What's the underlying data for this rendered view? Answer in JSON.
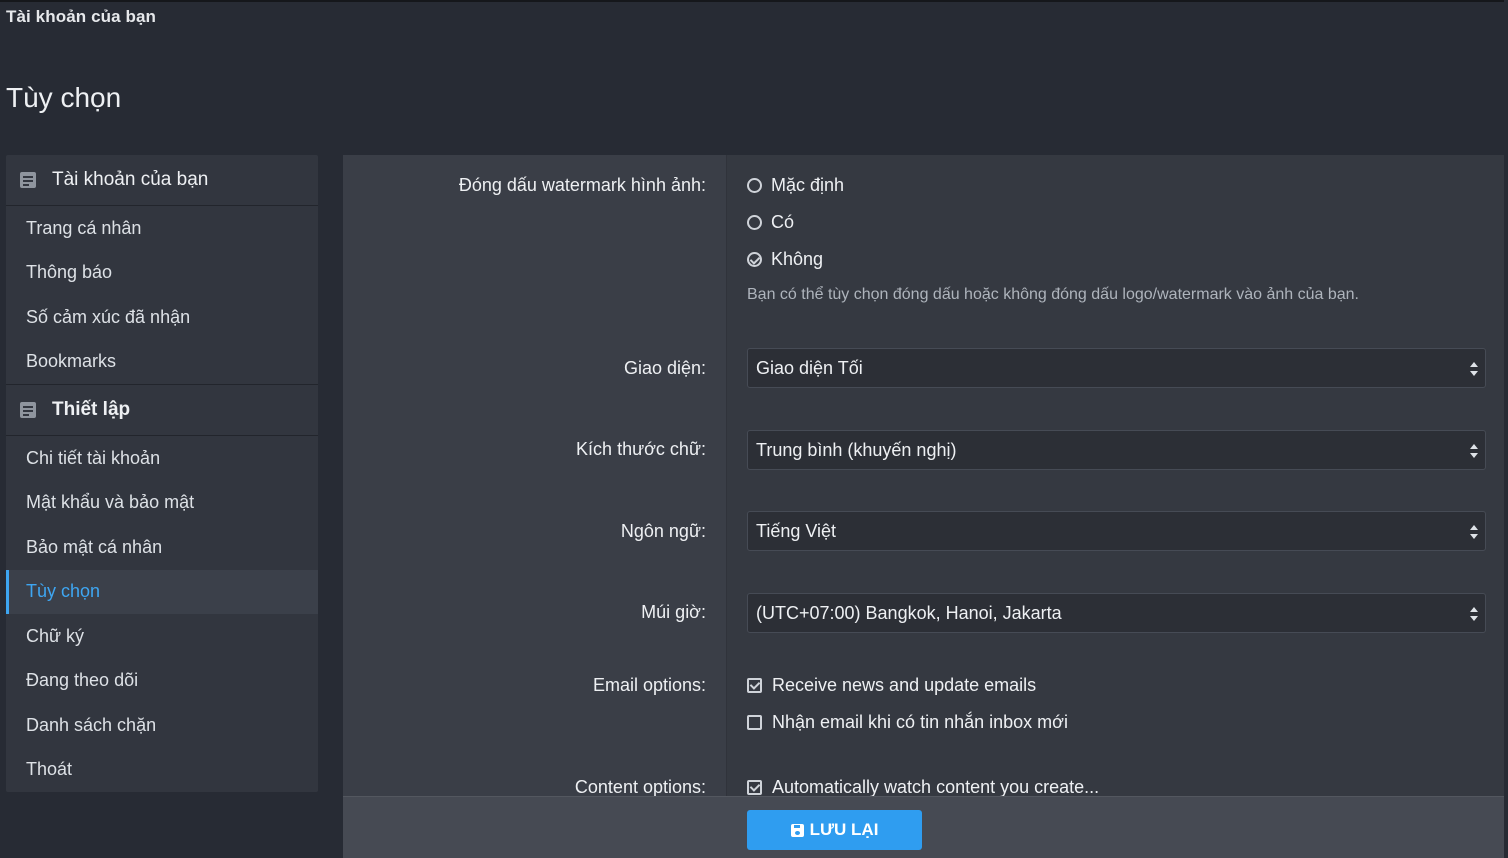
{
  "breadcrumb": "Tài khoản của bạn",
  "page_title": "Tùy chọn",
  "sidebar": {
    "groups": [
      {
        "header": "Tài khoản của bạn",
        "items": [
          "Trang cá nhân",
          "Thông báo",
          "Số cảm xúc đã nhận",
          "Bookmarks"
        ]
      },
      {
        "header": "Thiết lập",
        "items": [
          "Chi tiết tài khoản",
          "Mật khẩu và bảo mật",
          "Bảo mật cá nhân",
          "Tùy chọn",
          "Chữ ký",
          "Đang theo dõi",
          "Danh sách chặn",
          "Thoát"
        ]
      }
    ],
    "active_item": "Tùy chọn"
  },
  "form": {
    "watermark": {
      "label": "Đóng dấu watermark hình ảnh:",
      "options": [
        "Mặc định",
        "Có",
        "Không"
      ],
      "selected": "Không",
      "hint": "Bạn có thể tùy chọn đóng dấu hoặc không đóng dấu logo/watermark vào ảnh của bạn."
    },
    "theme": {
      "label": "Giao diện:",
      "value": "Giao diện Tối"
    },
    "font_size": {
      "label": "Kích thước chữ:",
      "value": "Trung bình (khuyến nghị)"
    },
    "language": {
      "label": "Ngôn ngữ:",
      "value": "Tiếng Việt"
    },
    "timezone": {
      "label": "Múi giờ:",
      "value": "(UTC+07:00) Bangkok, Hanoi, Jakarta"
    },
    "email_options": {
      "label": "Email options:",
      "items": [
        {
          "text": "Receive news and update emails",
          "checked": true
        },
        {
          "text": "Nhận email khi có tin nhắn inbox mới",
          "checked": false
        }
      ]
    },
    "content_options": {
      "label": "Content options:",
      "items": [
        {
          "text": "Automatically watch content you create...",
          "checked": true
        }
      ]
    }
  },
  "footer": {
    "save_label": "LƯU LẠI"
  },
  "colors": {
    "accent": "#3ea6f2",
    "button": "#2f9df0",
    "background": "#272b34"
  }
}
